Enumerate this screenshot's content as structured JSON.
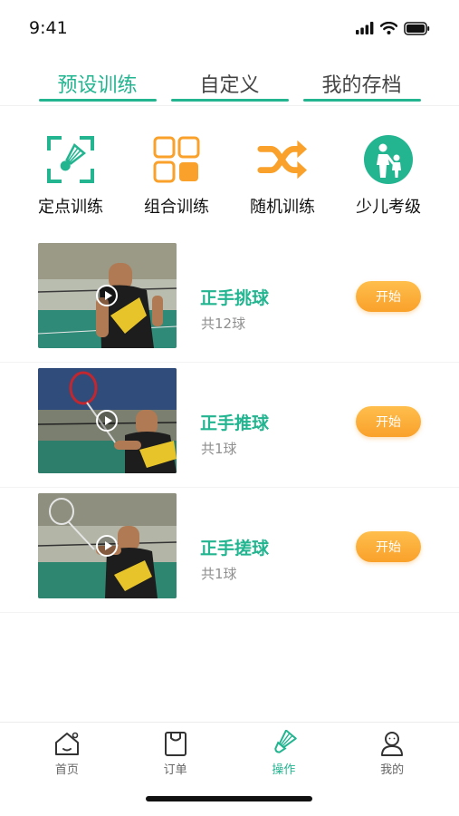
{
  "status": {
    "time": "9:41"
  },
  "tabs": [
    {
      "label": "预设训练",
      "active": true
    },
    {
      "label": "自定义",
      "active": false
    },
    {
      "label": "我的存档",
      "active": false
    }
  ],
  "categories": [
    {
      "label": "定点训练",
      "icon": "target-shuttlecock-icon"
    },
    {
      "label": "组合训练",
      "icon": "grid-icon"
    },
    {
      "label": "随机训练",
      "icon": "shuffle-icon"
    },
    {
      "label": "少儿考级",
      "icon": "parent-child-icon"
    }
  ],
  "trainings": [
    {
      "title": "正手挑球",
      "count": "共12球",
      "start_label": "开始"
    },
    {
      "title": "正手推球",
      "count": "共1球",
      "start_label": "开始"
    },
    {
      "title": "正手搓球",
      "count": "共1球",
      "start_label": "开始"
    }
  ],
  "tabbar": [
    {
      "label": "首页",
      "icon": "home-icon",
      "active": false
    },
    {
      "label": "订单",
      "icon": "order-bag-icon",
      "active": false
    },
    {
      "label": "操作",
      "icon": "shuttlecock-icon",
      "active": true
    },
    {
      "label": "我的",
      "icon": "profile-icon",
      "active": false
    }
  ],
  "colors": {
    "accent": "#23b490",
    "orange": "#f9a12b",
    "text": "#111111"
  }
}
